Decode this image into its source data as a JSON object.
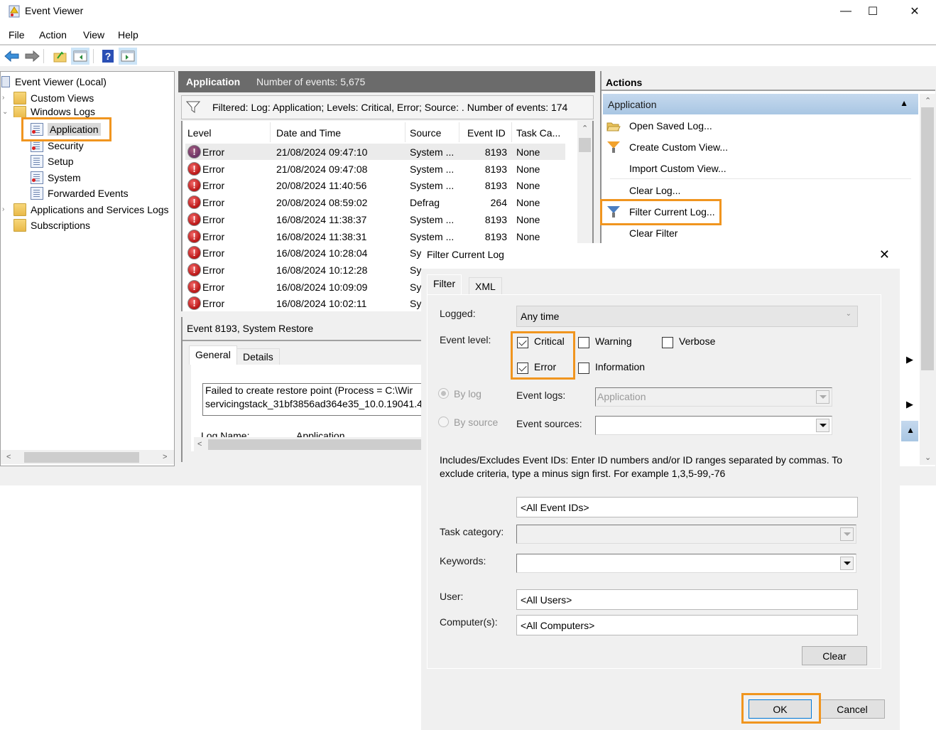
{
  "window": {
    "title": "Event Viewer",
    "controls": {
      "minimize": "—",
      "maximize": "☐",
      "close": "✕"
    }
  },
  "menu": [
    "File",
    "Action",
    "View",
    "Help"
  ],
  "toolbar": {
    "buttons": [
      "back-arrow-icon",
      "forward-arrow-icon",
      "up-folder-icon",
      "show-hide-console-tree-icon",
      "help-icon",
      "show-hide-action-pane-icon"
    ]
  },
  "tree": {
    "root": "Event Viewer (Local)",
    "items": [
      {
        "label": "Custom Views",
        "expander": "›"
      },
      {
        "label": "Windows Logs",
        "expander": "⌄"
      },
      {
        "label": "Application"
      },
      {
        "label": "Security"
      },
      {
        "label": "Setup"
      },
      {
        "label": "System"
      },
      {
        "label": "Forwarded Events"
      },
      {
        "label": "Applications and Services Logs",
        "expander": "›"
      },
      {
        "label": "Subscriptions"
      }
    ],
    "selected": "Application"
  },
  "center": {
    "log_name": "Application",
    "event_count": "Number of events: 5,675",
    "filter_text": "Filtered: Log: Application; Levels: Critical, Error; Source: . Number of events: 174",
    "columns": [
      "Level",
      "Date and Time",
      "Source",
      "Event ID",
      "Task Ca..."
    ],
    "rows": [
      {
        "level": "Error",
        "datetime": "21/08/2024 09:47:10",
        "source": "System ...",
        "event_id": "8193",
        "task": "None"
      },
      {
        "level": "Error",
        "datetime": "21/08/2024 09:47:08",
        "source": "System ...",
        "event_id": "8193",
        "task": "None"
      },
      {
        "level": "Error",
        "datetime": "20/08/2024 11:40:56",
        "source": "System ...",
        "event_id": "8193",
        "task": "None"
      },
      {
        "level": "Error",
        "datetime": "20/08/2024 08:59:02",
        "source": "Defrag",
        "event_id": "264",
        "task": "None"
      },
      {
        "level": "Error",
        "datetime": "16/08/2024 11:38:37",
        "source": "System ...",
        "event_id": "8193",
        "task": "None"
      },
      {
        "level": "Error",
        "datetime": "16/08/2024 11:38:31",
        "source": "System ...",
        "event_id": "8193",
        "task": "None"
      },
      {
        "level": "Error",
        "datetime": "16/08/2024 10:28:04",
        "source": "Sy",
        "event_id": "",
        "task": ""
      },
      {
        "level": "Error",
        "datetime": "16/08/2024 10:12:28",
        "source": "Sy",
        "event_id": "",
        "task": ""
      },
      {
        "level": "Error",
        "datetime": "16/08/2024 10:09:09",
        "source": "Sy",
        "event_id": "",
        "task": ""
      },
      {
        "level": "Error",
        "datetime": "16/08/2024 10:02:11",
        "source": "Sy",
        "event_id": "",
        "task": ""
      }
    ],
    "details": {
      "title": "Event 8193, System Restore",
      "tabs": [
        "General",
        "Details"
      ],
      "message_line1": "Failed to create restore point (Process = C:\\Wir",
      "message_line2": "servicingstack_31bf3856ad364e35_10.0.19041.4",
      "log_name_label": "Log Name:",
      "log_name_value": "Application"
    }
  },
  "actions": {
    "header": "Actions",
    "section": "Application",
    "items": [
      {
        "label": "Open Saved Log...",
        "icon": "open-folder-icon"
      },
      {
        "label": "Create Custom View...",
        "icon": "funnel-icon"
      },
      {
        "label": "Import Custom View...",
        "icon": ""
      },
      {
        "label": "Clear Log...",
        "icon": ""
      },
      {
        "label": "Filter Current Log...",
        "icon": "funnel-icon"
      },
      {
        "label": "Clear Filter",
        "icon": ""
      }
    ]
  },
  "dialog": {
    "title": "Filter Current Log",
    "close": "✕",
    "tabs": [
      "Filter",
      "XML"
    ],
    "logged_label": "Logged:",
    "logged_value": "Any time",
    "event_level_label": "Event level:",
    "levels": [
      {
        "label": "Critical",
        "checked": true
      },
      {
        "label": "Warning",
        "checked": false
      },
      {
        "label": "Verbose",
        "checked": false
      },
      {
        "label": "Error",
        "checked": true
      },
      {
        "label": "Information",
        "checked": false
      }
    ],
    "by_log_label": "By log",
    "by_source_label": "By source",
    "event_logs_label": "Event logs:",
    "event_logs_value": "Application",
    "event_sources_label": "Event sources:",
    "event_sources_value": "",
    "help_text": "Includes/Excludes Event IDs: Enter ID numbers and/or ID ranges separated by commas. To exclude criteria, type a minus sign first. For example 1,3,5-99,-76",
    "event_ids_value": "<All Event IDs>",
    "task_category_label": "Task category:",
    "keywords_label": "Keywords:",
    "user_label": "User:",
    "user_value": "<All Users>",
    "computers_label": "Computer(s):",
    "computers_value": "<All Computers>",
    "clear_button": "Clear",
    "ok_button": "OK",
    "cancel_button": "Cancel"
  },
  "highlight_color": "#f0951f"
}
